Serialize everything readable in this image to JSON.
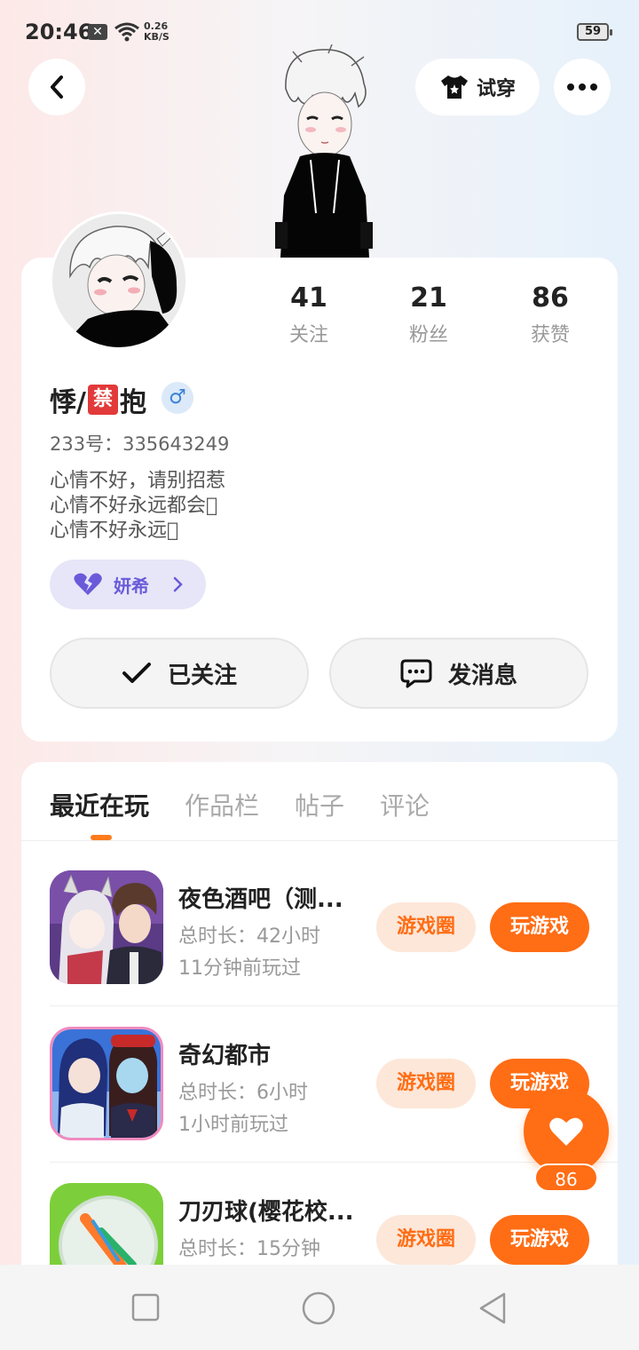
{
  "status_bar": {
    "time": "20:46",
    "speed_value": "0.26",
    "speed_unit": "KB/S",
    "battery": "59"
  },
  "header": {
    "try_on_label": "试穿"
  },
  "profile": {
    "name_prefix": "悸/",
    "name_banned": "禁",
    "name_suffix": "抱",
    "gender_symbol": "♂",
    "uid": "233号：335643249",
    "bio_lines": [
      "心情不好，请别招惹",
      "心情不好永远都会\u0000",
      "心情不好永远\u0000"
    ],
    "cp_name": "妍希",
    "stats": [
      {
        "value": "41",
        "label": "关注"
      },
      {
        "value": "21",
        "label": "粉丝"
      },
      {
        "value": "86",
        "label": "获赞"
      }
    ],
    "follow_label": "已关注",
    "message_label": "发消息"
  },
  "tabs": [
    "最近在玩",
    "作品栏",
    "帖子",
    "评论"
  ],
  "games": [
    {
      "title": "夜色酒吧（测...",
      "time": "总时长：42小时",
      "last": "11分钟前玩过",
      "circle_label": "游戏圈",
      "play_label": "玩游戏"
    },
    {
      "title": "奇幻都市",
      "time": "总时长：6小时",
      "last": "1小时前玩过",
      "circle_label": "游戏圈",
      "play_label": "玩游戏"
    },
    {
      "title": "刀刃球(樱花校...",
      "time": "总时长：15分钟",
      "last": "",
      "circle_label": "游戏圈",
      "play_label": "玩游戏"
    }
  ],
  "like": {
    "count": "86"
  },
  "colors": {
    "accent": "#ff6d14",
    "accent_light": "#fde7d9",
    "cp_purple": "#6a5ad9"
  }
}
